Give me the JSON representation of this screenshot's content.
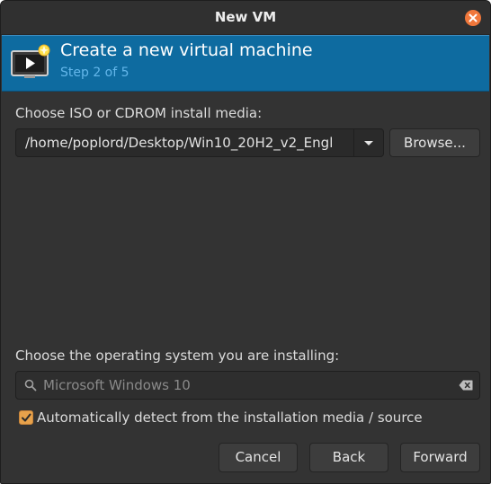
{
  "window": {
    "title": "New VM"
  },
  "header": {
    "title": "Create a new virtual machine",
    "step": "Step 2 of 5"
  },
  "install_media": {
    "label": "Choose ISO or CDROM install media:",
    "path_value": "/home/poplord/Desktop/Win10_20H2_v2_Engl",
    "browse_label": "Browse..."
  },
  "os": {
    "label": "Choose the operating system you are installing:",
    "search_placeholder": "Microsoft Windows 10",
    "autodetect_label": "Automatically detect from the installation media / source",
    "autodetect_checked": true
  },
  "buttons": {
    "cancel": "Cancel",
    "back": "Back",
    "forward": "Forward"
  },
  "colors": {
    "header_bg": "#0e6ba0",
    "close_button": "#f0773b",
    "checkbox": "#e8a24b"
  }
}
